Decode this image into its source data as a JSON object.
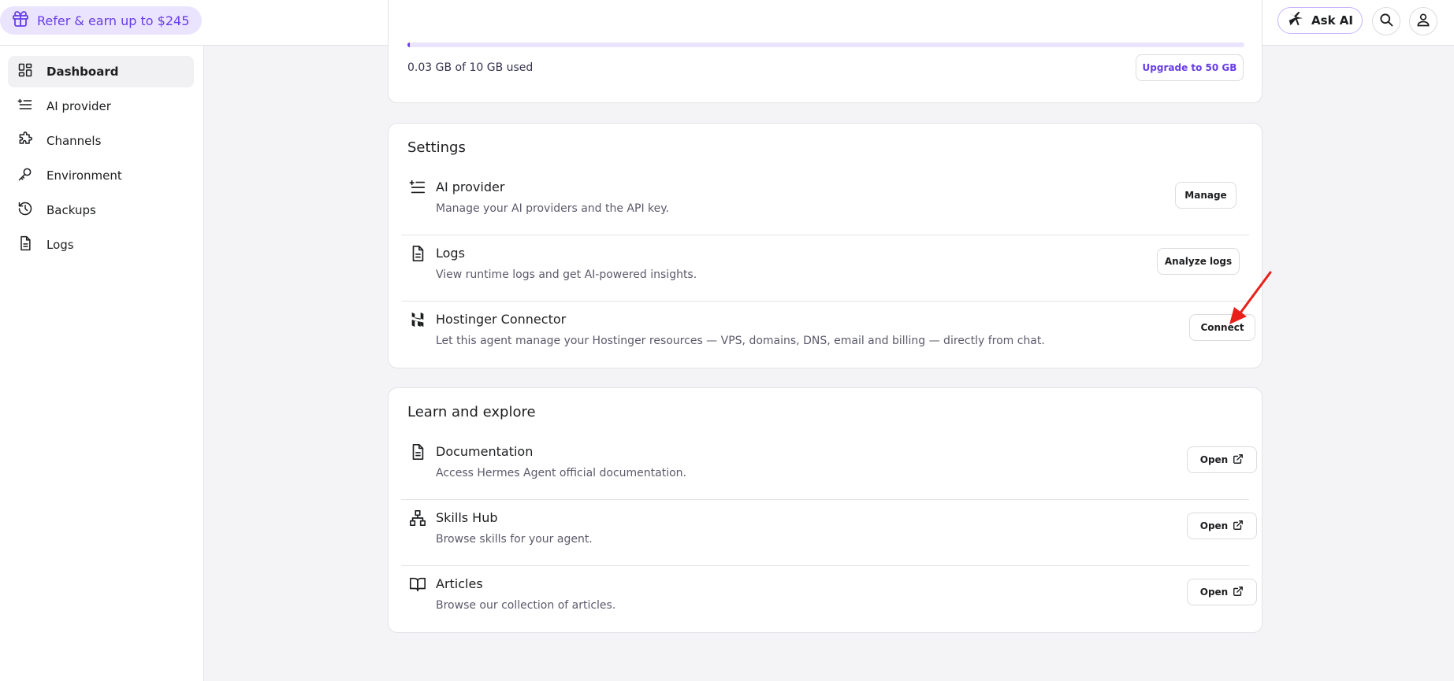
{
  "topbar": {
    "refer_label": "Refer & earn up to $245",
    "ask_ai_label": "Ask AI"
  },
  "sidebar": {
    "items": [
      {
        "label": "Dashboard",
        "icon": "dashboard-icon",
        "active": true
      },
      {
        "label": "AI provider",
        "icon": "list-icon"
      },
      {
        "label": "Channels",
        "icon": "puzzle-icon"
      },
      {
        "label": "Environment",
        "icon": "key-icon"
      },
      {
        "label": "Backups",
        "icon": "history-icon"
      },
      {
        "label": "Logs",
        "icon": "document-icon"
      }
    ]
  },
  "storage": {
    "used_text": "0.03 GB of 10 GB used",
    "used_fraction": 0.003,
    "upgrade_label": "Upgrade to 50 GB"
  },
  "settings": {
    "title": "Settings",
    "rows": [
      {
        "title": "AI provider",
        "desc": "Manage your AI providers and the API key.",
        "button": "Manage",
        "icon": "list-icon"
      },
      {
        "title": "Logs",
        "desc": "View runtime logs and get AI-powered insights.",
        "button": "Analyze logs",
        "icon": "document-icon"
      },
      {
        "title": "Hostinger Connector",
        "desc": "Let this agent manage your Hostinger resources — VPS, domains, DNS, email and billing — directly from chat.",
        "button": "Connect",
        "icon": "hostinger-logo-icon"
      }
    ]
  },
  "learn": {
    "title": "Learn and explore",
    "rows": [
      {
        "title": "Documentation",
        "desc": "Access Hermes Agent official documentation.",
        "button": "Open",
        "icon": "document-icon"
      },
      {
        "title": "Skills Hub",
        "desc": "Browse skills for your agent.",
        "button": "Open",
        "icon": "sitemap-icon"
      },
      {
        "title": "Articles",
        "desc": "Browse our collection of articles.",
        "button": "Open",
        "icon": "book-icon"
      }
    ]
  },
  "colors": {
    "brand": "#673de6",
    "brand_light": "#ebe4ff",
    "annotation_arrow": "#e8201a"
  }
}
